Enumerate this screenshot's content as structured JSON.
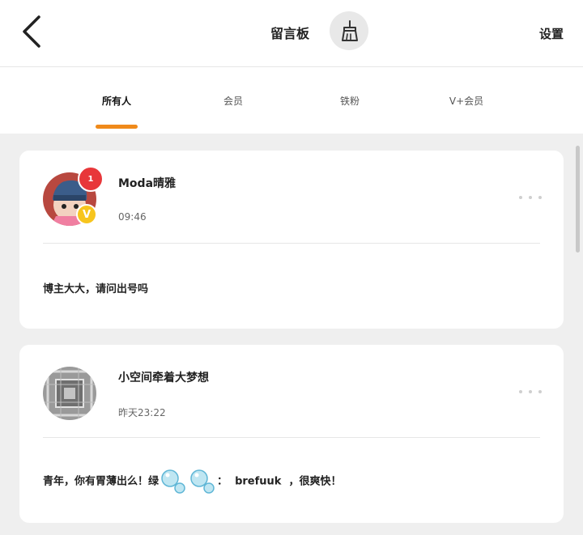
{
  "header": {
    "back_icon": "chevron-left-icon",
    "title": "留言板",
    "broom_icon": "broom-icon",
    "settings_label": "设置"
  },
  "tabs": [
    {
      "label": "所有人",
      "active": true
    },
    {
      "label": "会员",
      "active": false
    },
    {
      "label": "铁粉",
      "active": false
    },
    {
      "label": "V+会员",
      "active": false
    }
  ],
  "colors": {
    "accent": "#f08a1a",
    "badge_red": "#e8373a",
    "vip_gold": "#f7c51e"
  },
  "messages": [
    {
      "username": "Moda晴雅",
      "time": "09:46",
      "notification_count": "1",
      "vip_badge": "V",
      "content": "博主大大，请问出号吗"
    },
    {
      "username": "小空间牵着大梦想",
      "time": "昨天23:22",
      "content_before": "青年，你有胃薄出么！绿",
      "content_after": "：  brefuuk  ，很爽快！"
    }
  ]
}
